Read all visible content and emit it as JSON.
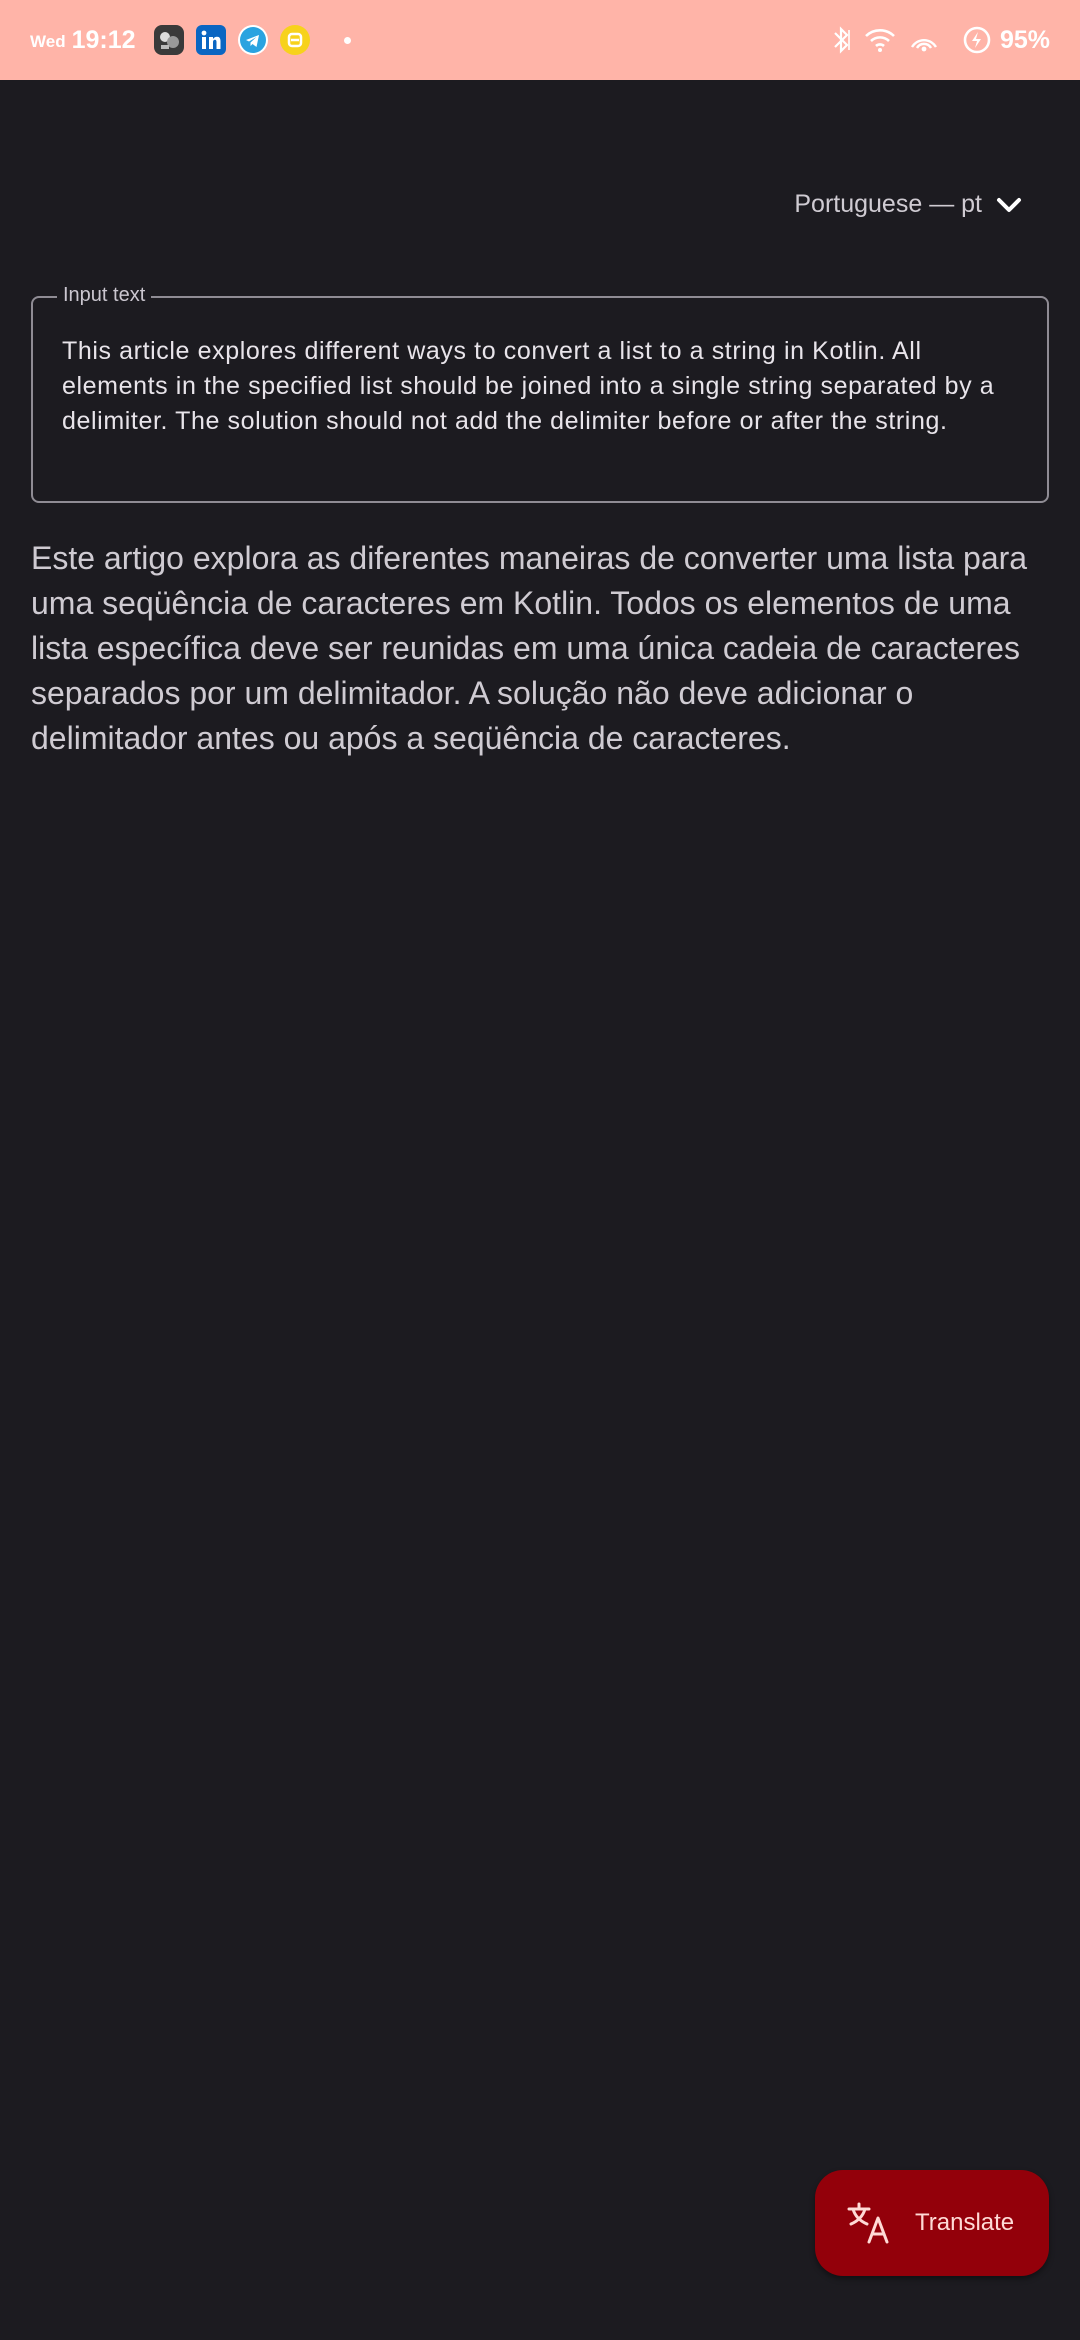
{
  "status_bar": {
    "day": "Wed",
    "time": "19:12",
    "battery_percent": "95%",
    "notification_icons": [
      "game-app-icon",
      "linkedin-icon",
      "telegram-icon",
      "yellow-app-icon"
    ],
    "right_icons": [
      "bluetooth-icon",
      "wifi-icon",
      "hotspot-icon",
      "battery-charging-icon"
    ],
    "colors": {
      "background": "#ffb4a8",
      "text": "#ffffff"
    }
  },
  "language_selector": {
    "label": "Portuguese — pt",
    "icon": "chevron-down-icon"
  },
  "input": {
    "label": "Input text",
    "value": "This article explores different ways to convert a list to a string in Kotlin. All elements in the specified list should be joined into a single string separated by a delimiter. The solution should not add the delimiter before or after the string."
  },
  "output": {
    "text": "Este artigo explora as diferentes maneiras de converter uma lista para uma seqüência de caracteres em Kotlin. Todos os elementos de uma lista específica deve ser reunidas em uma única cadeia de caracteres separados por um delimitador. A solução não deve adicionar o delimitador antes ou após a seqüência de caracteres."
  },
  "fab": {
    "label": "Translate",
    "icon": "translate-icon",
    "colors": {
      "background": "#93000a",
      "foreground": "#ffdad6"
    }
  },
  "colors": {
    "background": "#1c1b20",
    "outline": "#8f8c94"
  }
}
